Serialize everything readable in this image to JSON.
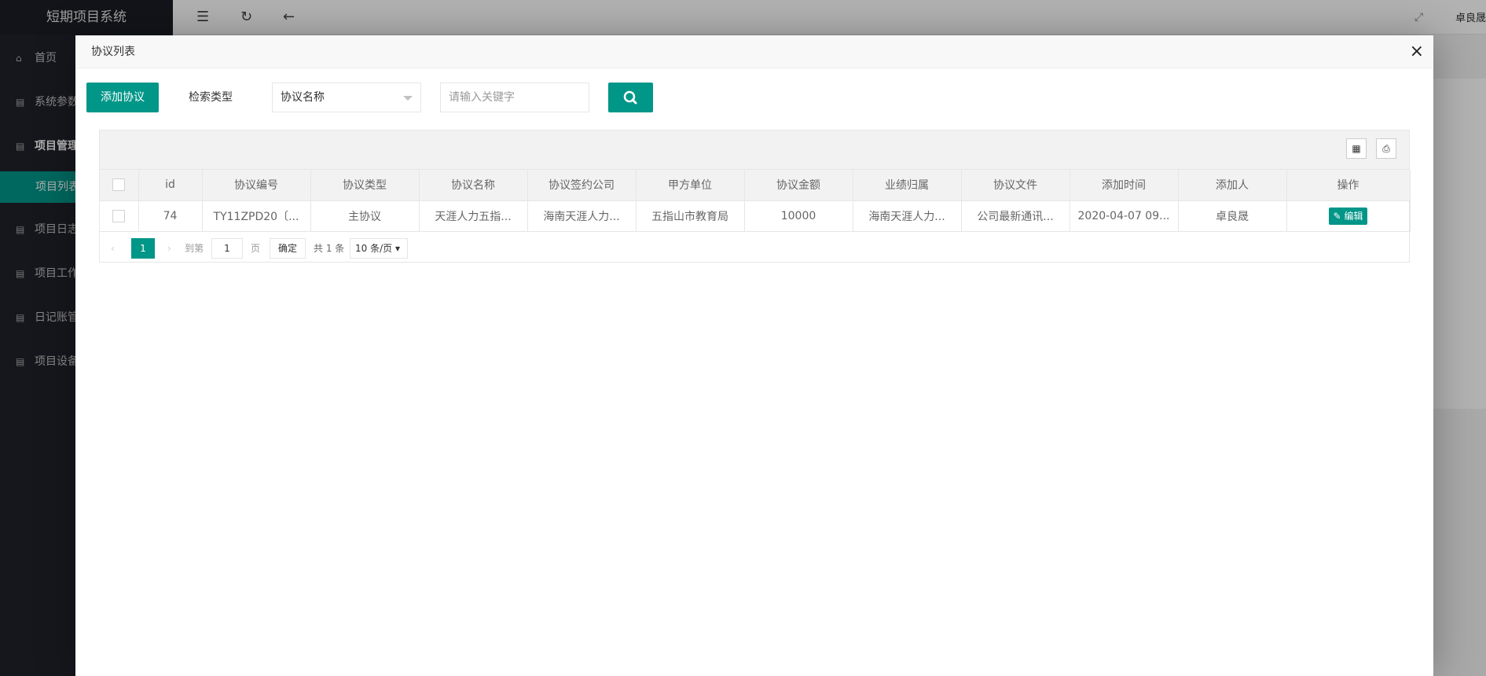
{
  "app": {
    "title": "短期项目系统",
    "user": "卓良晟"
  },
  "sidebar": {
    "items": [
      {
        "label": "首页",
        "icon": "home-icon"
      },
      {
        "label": "系统参数",
        "icon": "file-icon"
      },
      {
        "label": "项目管理",
        "icon": "file-icon"
      },
      {
        "label": "项目列表",
        "icon": ""
      },
      {
        "label": "项目日志",
        "icon": "file-icon"
      },
      {
        "label": "项目工作",
        "icon": "file-icon"
      },
      {
        "label": "日记账管",
        "icon": "file-icon"
      },
      {
        "label": "项目设备",
        "icon": "file-icon"
      }
    ]
  },
  "modal": {
    "title": "协议列表",
    "close": "×",
    "toolbar": {
      "add_label": "添加协议",
      "search_type_label": "检索类型",
      "search_type_value": "协议名称",
      "keyword_placeholder": "请输入关键字"
    },
    "table": {
      "headers": [
        "id",
        "协议编号",
        "协议类型",
        "协议名称",
        "协议签约公司",
        "甲方单位",
        "协议金额",
        "业绩归属",
        "协议文件",
        "添加时间",
        "添加人",
        "操作"
      ],
      "rows": [
        [
          "74",
          "TY11ZPD20〔...",
          "主协议",
          "天涯人力五指...",
          "海南天涯人力...",
          "五指山市教育局",
          "10000",
          "海南天涯人力...",
          "公司最新通讯...",
          "2020-04-07 09...",
          "卓良晟",
          "编辑"
        ]
      ]
    },
    "pager": {
      "current": "1",
      "goto_label": "到第",
      "page_input": "1",
      "page_suffix": "页",
      "confirm": "确定",
      "total": "共 1 条",
      "per_page": "10 条/页"
    }
  },
  "colors": {
    "accent": "#009688",
    "sidebar": "#20222a"
  }
}
